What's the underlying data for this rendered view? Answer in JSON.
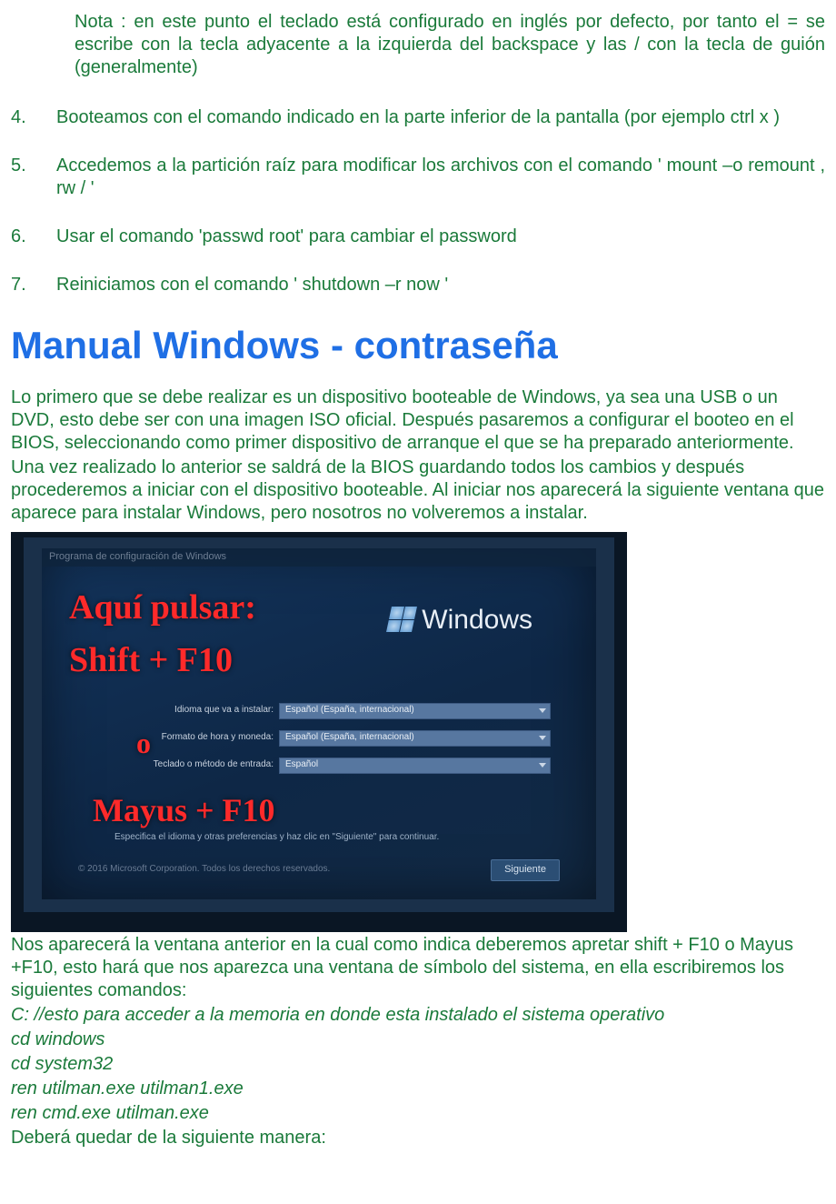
{
  "note": "Nota : en este punto el teclado está configurado en inglés por defecto, por tanto el = se escribe con la tecla adyacente a la izquierda del backspace y las / con la tecla de guión (generalmente)",
  "steps": {
    "n4": {
      "num": "4.",
      "text": "Booteamos con el comando indicado en la parte inferior de la pantalla (por ejemplo ctrl x )"
    },
    "n5": {
      "num": "5.",
      "text": "Accedemos a la partición raíz para modificar los archivos con el comando ' mount –o remount , rw / '"
    },
    "n6": {
      "num": "6.",
      "text": "Usar el comando 'passwd root' para cambiar el password"
    },
    "n7": {
      "num": "7.",
      "text": "Reiniciamos con el comando ' shutdown –r now '"
    }
  },
  "heading": "Manual Windows - contraseña",
  "para1": "Lo primero que se debe realizar es un dispositivo booteable de Windows, ya sea una USB o un DVD, esto debe ser con una imagen ISO oficial. Después pasaremos a configurar el booteo en el BIOS, seleccionando como primer dispositivo de arranque el que se ha preparado anteriormente.",
  "para2": "Una vez realizado lo anterior se saldrá de la BIOS guardando todos los cambios y después procederemos a iniciar con el dispositivo booteable. Al iniciar nos aparecerá la siguiente ventana que aparece para instalar Windows, pero nosotros no volveremos a instalar.",
  "screenshot": {
    "titlebar": "Programa de configuración de Windows",
    "brand": "Windows",
    "overlay1": "Aquí pulsar:",
    "overlay2": "Shift + F10",
    "overlay3": "o",
    "overlay4": "Mayus + F10",
    "row1": {
      "label": "Idioma que va a instalar:",
      "value": "Español (España, internacional)"
    },
    "row2": {
      "label": "Formato de hora y moneda:",
      "value": "Español (España, internacional)"
    },
    "row3": {
      "label": "Teclado o método de entrada:",
      "value": "Español"
    },
    "hint": "Especifica el idioma y otras preferencias y haz clic en \"Siguiente\" para continuar.",
    "copy": "© 2016 Microsoft Corporation. Todos los derechos reservados.",
    "next": "Siguiente"
  },
  "para3": "Nos aparecerá la ventana anterior en la cual como indica deberemos apretar shift + F10 o Mayus +F10, esto hará que nos aparezca una ventana de símbolo del sistema, en ella escribiremos los siguientes comandos:",
  "cmd1": "C:  //esto para acceder a la memoria en donde esta instalado el sistema operativo",
  "cmd2": "cd windows",
  "cmd3": "cd system32",
  "cmd4": "ren utilman.exe utilman1.exe",
  "cmd5": "ren cmd.exe utilman.exe",
  "para4": "Deberá quedar de la siguiente manera:"
}
